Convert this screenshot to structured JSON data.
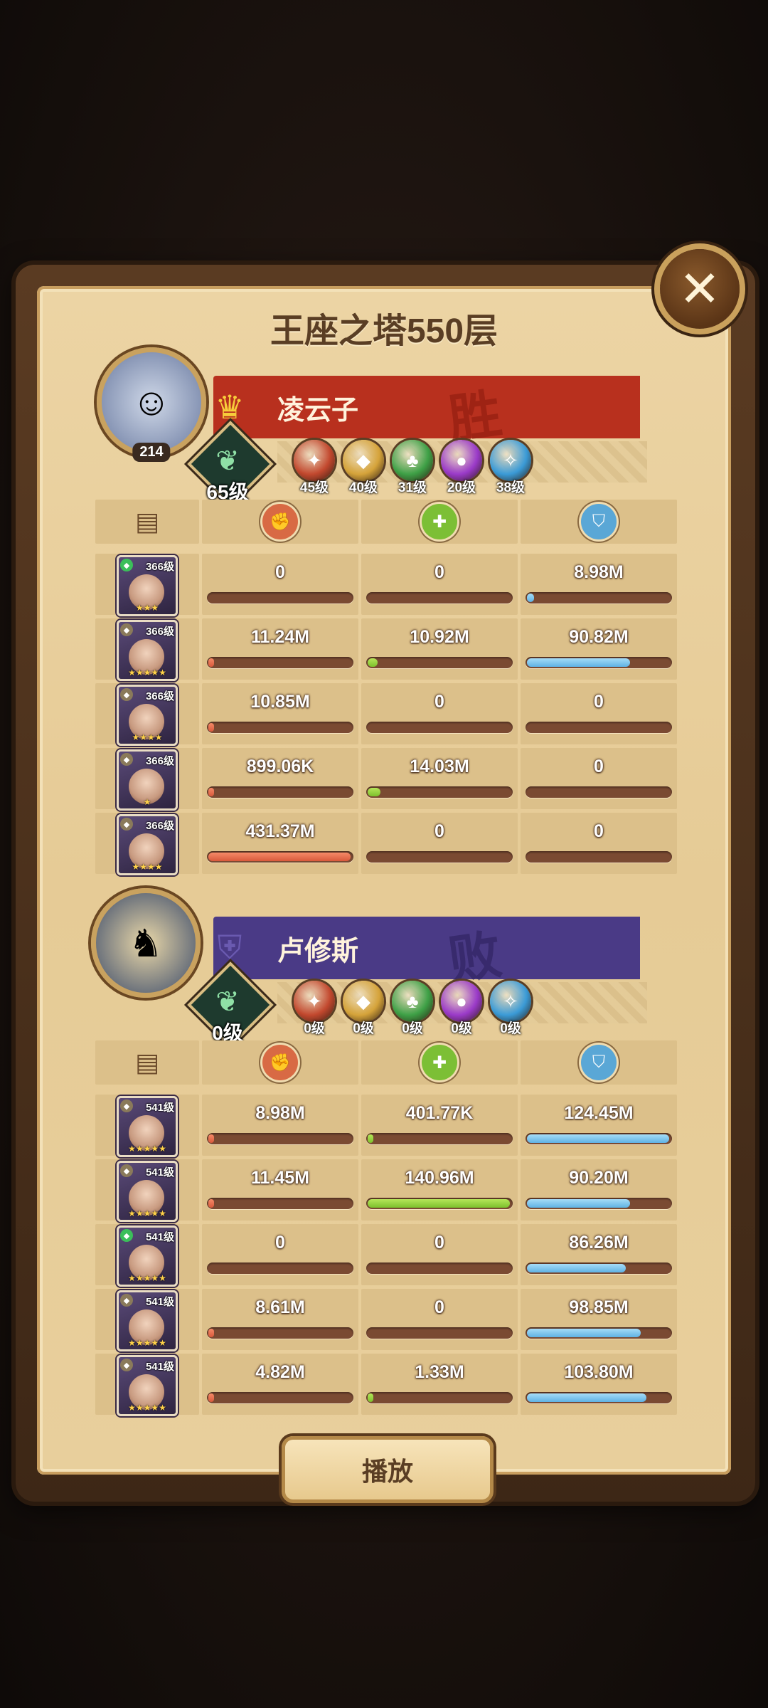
{
  "title": "王座之塔550层",
  "close_icon": "close-x-icon",
  "play_label": "播放",
  "stat_icons": [
    "damage-icon",
    "heal-icon",
    "shield-icon"
  ],
  "stat_icon_colors": [
    "#d86a44",
    "#7cbf35",
    "#5aa7d6"
  ],
  "teams": [
    {
      "player_name": "凌云子",
      "avatar_level": "214",
      "result": "胜",
      "banner_color": "#b8301e",
      "result_color": "#8a1a0c",
      "tree_level": "65级",
      "factions": [
        {
          "icon": "lightbearer-icon",
          "color": "#c2482e",
          "level": "45级"
        },
        {
          "icon": "mauler-icon",
          "color": "#d5a33a",
          "level": "40级"
        },
        {
          "icon": "wilder-icon",
          "color": "#3ea046",
          "level": "31级"
        },
        {
          "icon": "graveborn-icon",
          "color": "#9a3ac8",
          "level": "20级"
        },
        {
          "icon": "celestial-icon",
          "color": "#3a9ad6",
          "level": "38级"
        }
      ],
      "heroes": [
        {
          "level": "366级",
          "stars": "★★★",
          "badge_color": "#3bbf5a",
          "values": [
            "0",
            "0",
            "8.98M"
          ],
          "fills": [
            0,
            0,
            0.05
          ]
        },
        {
          "level": "366级",
          "stars": "★★★★★",
          "badge_color": "#8a7a5a",
          "values": [
            "11.24M",
            "10.92M",
            "90.82M"
          ],
          "fills": [
            0.02,
            0.07,
            0.72
          ]
        },
        {
          "level": "366级",
          "stars": "★★★★",
          "badge_color": "#8a7a5a",
          "values": [
            "10.85M",
            "0",
            "0"
          ],
          "fills": [
            0.02,
            0,
            0
          ]
        },
        {
          "level": "366级",
          "stars": "★",
          "badge_color": "#8a7a5a",
          "values": [
            "899.06K",
            "14.03M",
            "0"
          ],
          "fills": [
            0.005,
            0.09,
            0
          ]
        },
        {
          "level": "366级",
          "stars": "★★★★",
          "badge_color": "#8a7a5a",
          "values": [
            "431.37M",
            "0",
            "0"
          ],
          "fills": [
            0.99,
            0,
            0
          ]
        }
      ]
    },
    {
      "player_name": "卢修斯",
      "avatar_level": "",
      "result": "败",
      "banner_color": "#4a3a86",
      "result_color": "#2a1e5a",
      "tree_level": "0级",
      "factions": [
        {
          "icon": "lightbearer-icon",
          "color": "#c2482e",
          "level": "0级"
        },
        {
          "icon": "mauler-icon",
          "color": "#d5a33a",
          "level": "0级"
        },
        {
          "icon": "wilder-icon",
          "color": "#3ea046",
          "level": "0级"
        },
        {
          "icon": "graveborn-icon",
          "color": "#9a3ac8",
          "level": "0级"
        },
        {
          "icon": "celestial-icon",
          "color": "#3a9ad6",
          "level": "0级"
        }
      ],
      "heroes": [
        {
          "level": "541级",
          "stars": "★★★★★",
          "badge_color": "#8a7a5a",
          "values": [
            "8.98M",
            "401.77K",
            "124.45M"
          ],
          "fills": [
            0.02,
            0.01,
            0.99
          ]
        },
        {
          "level": "541级",
          "stars": "★★★★★",
          "badge_color": "#8a7a5a",
          "values": [
            "11.45M",
            "140.96M",
            "90.20M"
          ],
          "fills": [
            0.02,
            0.99,
            0.72
          ]
        },
        {
          "level": "541级",
          "stars": "★★★★★",
          "badge_color": "#3bbf5a",
          "values": [
            "0",
            "0",
            "86.26M"
          ],
          "fills": [
            0,
            0,
            0.69
          ]
        },
        {
          "level": "541级",
          "stars": "★★★★★",
          "badge_color": "#8a7a5a",
          "values": [
            "8.61M",
            "0",
            "98.85M"
          ],
          "fills": [
            0.02,
            0,
            0.79
          ]
        },
        {
          "level": "541级",
          "stars": "★★★★★",
          "badge_color": "#8a7a5a",
          "values": [
            "4.82M",
            "1.33M",
            "103.80M"
          ],
          "fills": [
            0.02,
            0.01,
            0.83
          ]
        }
      ]
    }
  ]
}
